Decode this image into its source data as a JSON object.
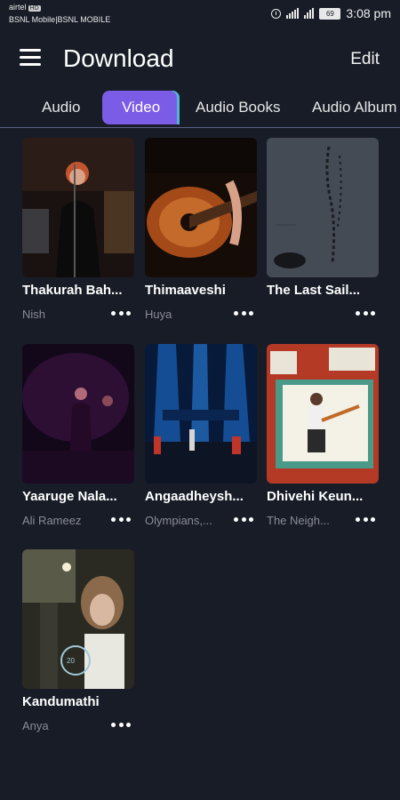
{
  "status_bar": {
    "carrier_line1": "airtel",
    "hd_badge": "HD",
    "carrier_line2": "BSNL Mobile|BSNL MOBILE",
    "battery": "69",
    "time": "3:08 pm"
  },
  "header": {
    "title": "Download",
    "edit_label": "Edit"
  },
  "tabs": [
    {
      "label": "Audio",
      "active": false
    },
    {
      "label": "Video",
      "active": true
    },
    {
      "label": "Audio Books",
      "active": false
    },
    {
      "label": "Audio Album",
      "active": false
    }
  ],
  "items": [
    {
      "title": "Thakurah Bah...",
      "artist": "Nish"
    },
    {
      "title": "Thimaaveshi",
      "artist": "Huya"
    },
    {
      "title": "The Last Sail...",
      "artist": ""
    },
    {
      "title": "Yaaruge Nala...",
      "artist": "Ali Rameez"
    },
    {
      "title": "Angaadheysh...",
      "artist": "Olympians,..."
    },
    {
      "title": "Dhivehi Keun...",
      "artist": "The Neigh..."
    },
    {
      "title": "Kandumathi",
      "artist": "Anya"
    }
  ],
  "colors": {
    "background": "#181c27",
    "accent": "#7b5ce6",
    "accent_edge": "#4fb6d6"
  }
}
